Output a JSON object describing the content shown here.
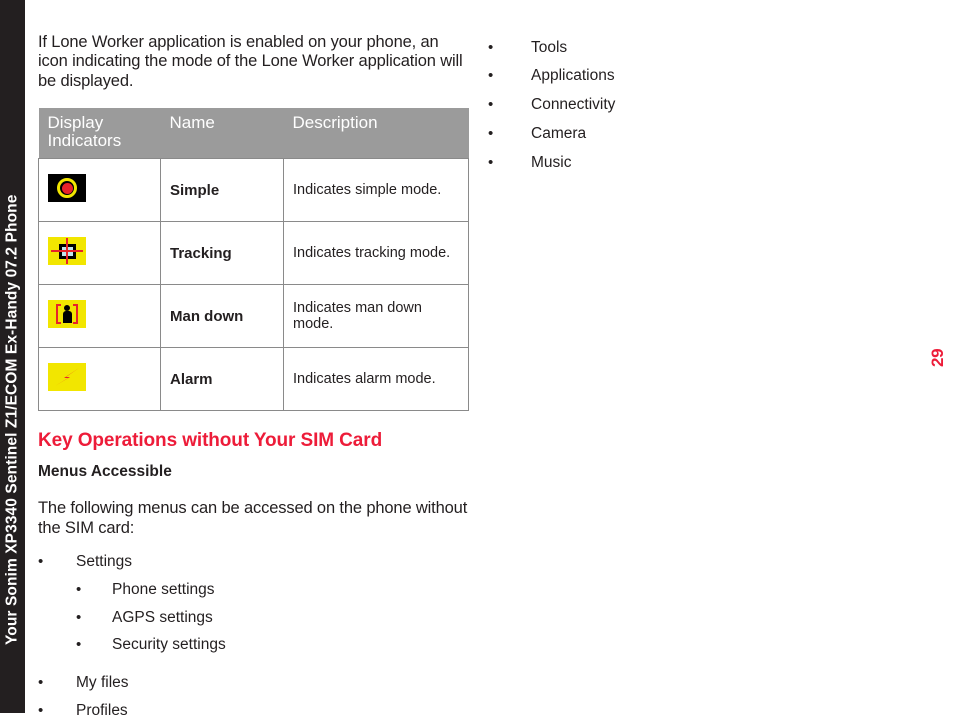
{
  "document": {
    "spine_label": "Your Sonim XP3340 Sentinel Z1/ECOM Ex-Handy 07.2 Phone",
    "page_number": "29",
    "accent_red": "#ed1c39",
    "spine_color": "#231f20",
    "table_header_gray": "#9b9b9b"
  },
  "left_column": {
    "intro_paragraph": "If Lone Worker application is enabled on your phone, an icon indicating the mode of the Lone Worker application will be displayed.",
    "table": {
      "headers": [
        "Display Indicators",
        "Name",
        "Description"
      ],
      "rows": [
        {
          "icon": "lone-worker-simple-icon",
          "name": "Simple",
          "description": "Indicates simple mode."
        },
        {
          "icon": "lone-worker-tracking-icon",
          "name": "Tracking",
          "description": "Indicates tracking mode."
        },
        {
          "icon": "lone-worker-man-down-icon",
          "name": "Man down",
          "description": "Indicates man down mode."
        },
        {
          "icon": "lone-worker-alarm-icon",
          "name": "Alarm",
          "description": "Indicates alarm mode."
        }
      ]
    },
    "section_heading": "Key Operations without Your SIM Card",
    "sub_heading": "Menus Accessible",
    "section_paragraph": "The following menus can be accessed on the phone without the SIM card:",
    "bullet_char": "•",
    "menu_list": [
      {
        "label": "Settings"
      },
      {
        "label": "My files"
      },
      {
        "label": "Profiles"
      }
    ],
    "settings_sub_list": [
      {
        "label": "Phone settings"
      },
      {
        "label": "AGPS settings"
      },
      {
        "label": "Security settings"
      }
    ]
  },
  "right_column": {
    "bullet_char": "•",
    "menu_list": [
      {
        "label": "Tools"
      },
      {
        "label": "Applications"
      },
      {
        "label": "Connectivity"
      },
      {
        "label": "Camera"
      },
      {
        "label": "Music"
      }
    ]
  }
}
